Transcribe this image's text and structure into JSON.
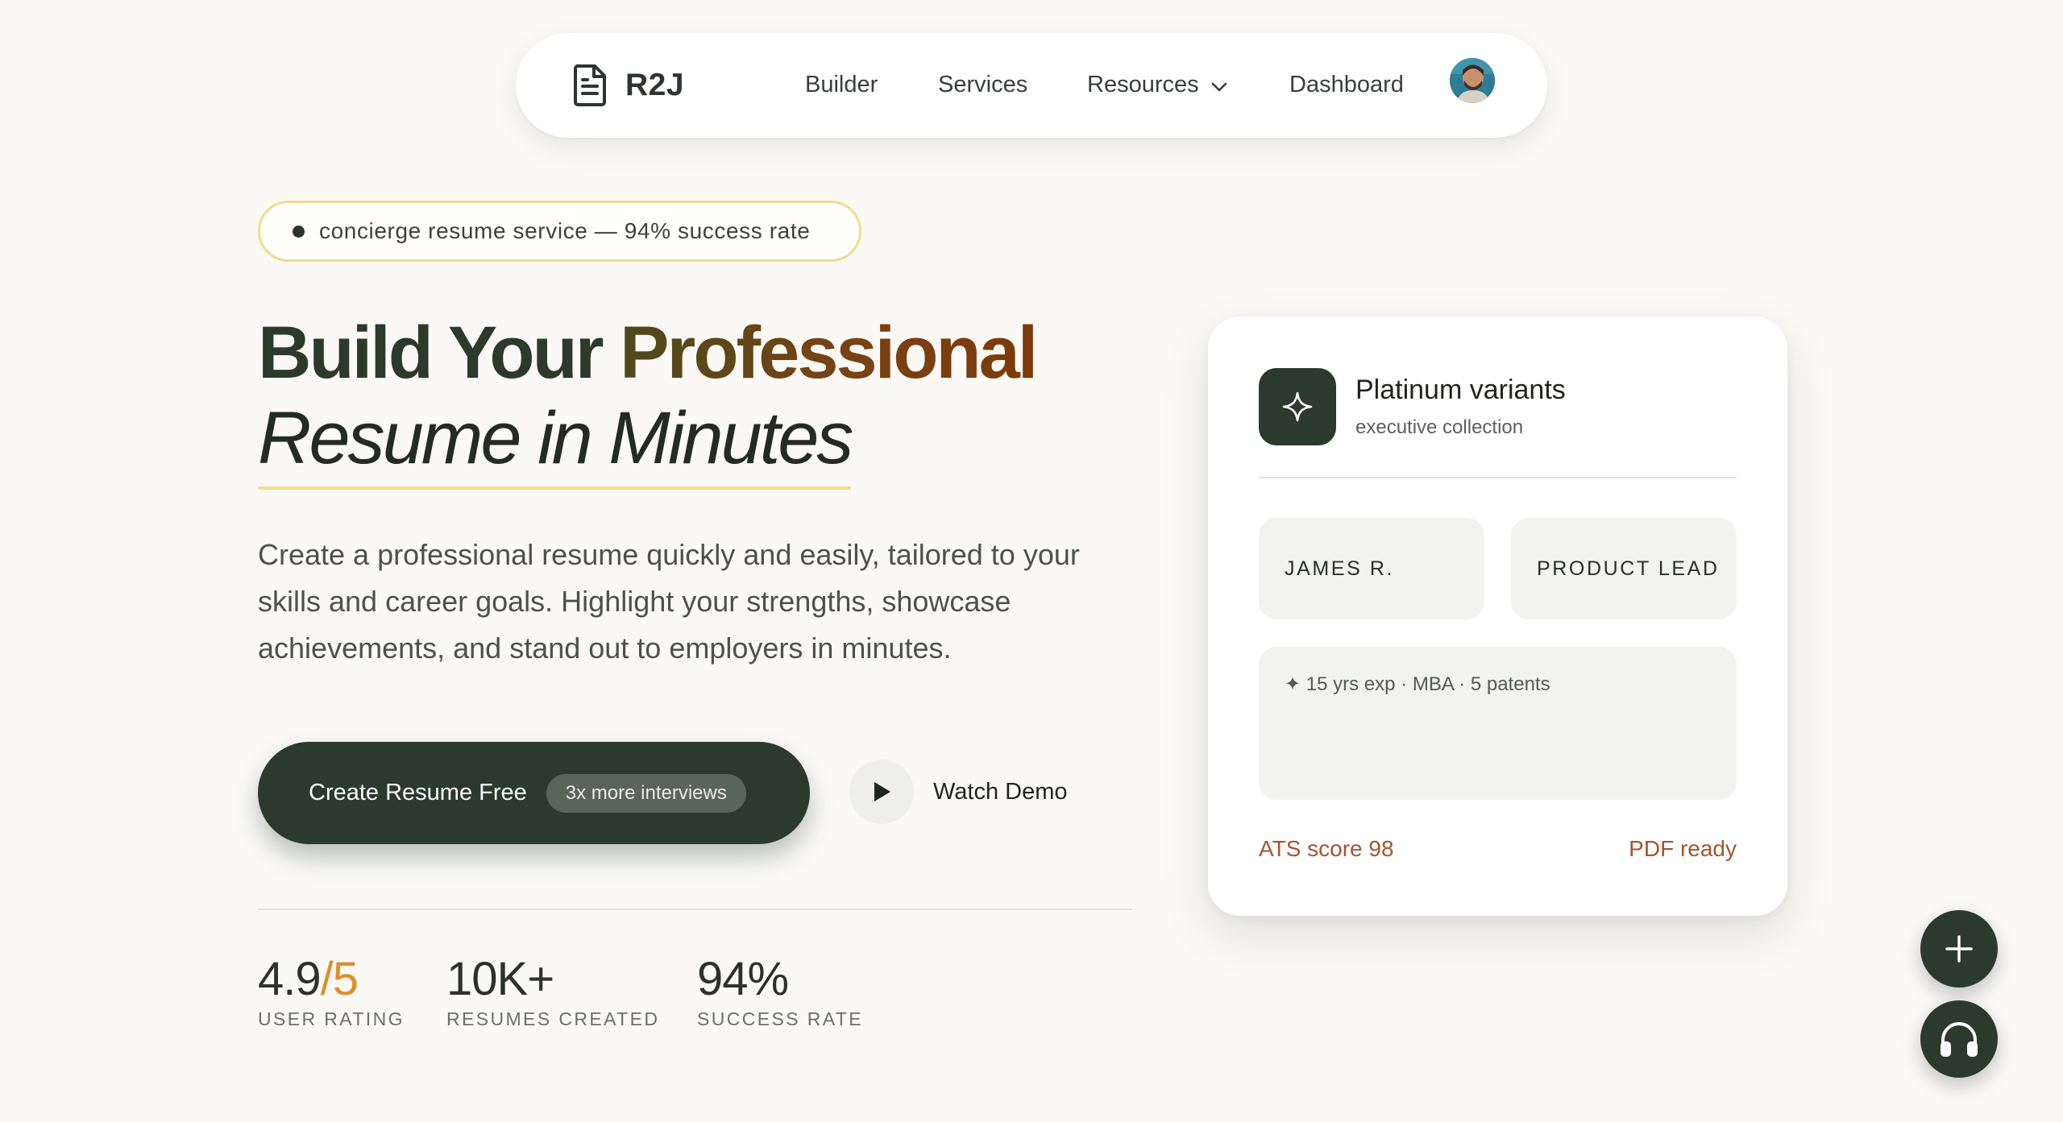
{
  "nav": {
    "brand": "R2J",
    "links": [
      "Builder",
      "Services",
      "Resources",
      "Dashboard"
    ]
  },
  "hero": {
    "badge": "concierge resume service — 94% success rate",
    "title_part1": "Build Your ",
    "title_part2": "Professional",
    "title_line2": "Resume in Minutes",
    "description": "Create a professional resume quickly and easily, tailored to your skills and career goals. Highlight your strengths, showcase achievements, and stand out to employers in minutes.",
    "cta_label": "Create Resume Free",
    "cta_badge": "3x more interviews",
    "demo_label": "Watch Demo"
  },
  "stats": [
    {
      "value": "4.9",
      "accent": "/5",
      "label": "USER RATING"
    },
    {
      "value": "10K+",
      "accent": "",
      "label": "RESUMES CREATED"
    },
    {
      "value": "94%",
      "accent": "",
      "label": "SUCCESS RATE"
    }
  ],
  "card": {
    "title": "Platinum variants",
    "subtitle": "executive collection",
    "name_chip": "JAMES R.",
    "role_chip": "PRODUCT LEAD",
    "summary": "✦ 15 yrs exp · MBA · 5 patents",
    "ats": "ATS score 98",
    "pdf": "PDF ready"
  },
  "colors": {
    "primary": "#2b3a2c",
    "accent_orange": "#e08d2a",
    "accent_rust": "#a4552e",
    "highlight_yellow": "#f2df8e",
    "background": "#faf9f6"
  },
  "icons": {
    "brand": "document-icon",
    "resources_dropdown": "chevron-down-icon",
    "card": "sparkle-icon",
    "demo": "play-icon",
    "fab_add": "plus-icon",
    "fab_support": "headphones-icon"
  }
}
